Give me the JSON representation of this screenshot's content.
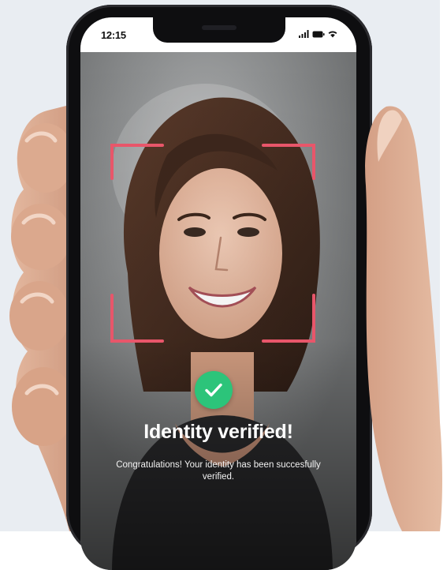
{
  "status_bar": {
    "time": "12:15",
    "icons": [
      "signal-icon",
      "battery-icon",
      "wifi-icon"
    ]
  },
  "verification": {
    "title": "Identity verified!",
    "message": "Congratulations! Your identity has been succesfully verified."
  },
  "colors": {
    "frame_accent": "#e8566a",
    "success": "#2cc47a",
    "background": "#e9edf2"
  }
}
